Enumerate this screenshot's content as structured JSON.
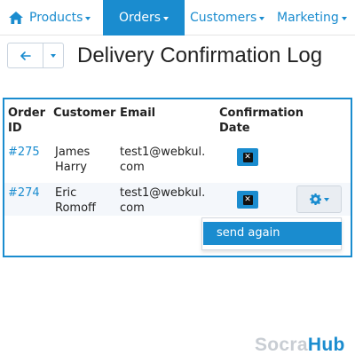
{
  "nav": {
    "items": [
      {
        "label": "Products",
        "icon": "home-icon"
      },
      {
        "label": "Orders",
        "active": true
      },
      {
        "label": "Customers"
      },
      {
        "label": "Marketing"
      }
    ]
  },
  "header": {
    "back_icon": "arrow-left-icon",
    "title": "Delivery Confirmation Log"
  },
  "table": {
    "columns": {
      "order_id_line1": "Order",
      "order_id_line2": "ID",
      "customer": "Customer",
      "email": "Email",
      "confirmation_line1": "Confirmation",
      "confirmation_line2": "Date"
    },
    "rows": [
      {
        "order_id": "#275",
        "customer_first": "James",
        "customer_last": "Harry",
        "email_line1": "test1@webkul.",
        "email_line2": "com",
        "delete_icon": "close-icon"
      },
      {
        "order_id": "#274",
        "customer_first": "Eric",
        "customer_last": "Romoff",
        "email_line1": "test1@webkul.",
        "email_line2": "com",
        "delete_icon": "close-icon",
        "actions_icon": "gear-icon"
      }
    ],
    "dropdown": {
      "items": [
        "send again"
      ]
    }
  },
  "watermark": {
    "part1": "Socra",
    "part2": "Hub"
  },
  "colors": {
    "accent": "#1a8ccf",
    "row_shade": "#f4f7fb",
    "text": "#222222"
  }
}
